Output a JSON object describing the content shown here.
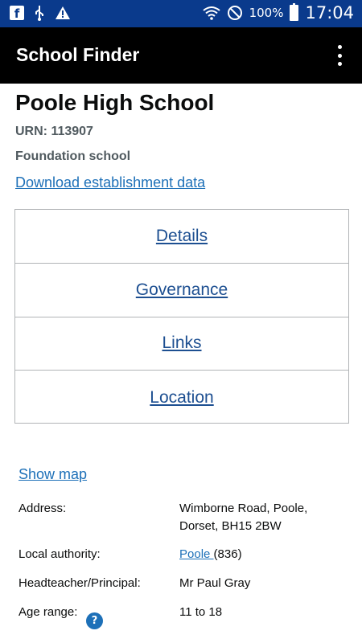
{
  "status_bar": {
    "icons_left": [
      "facebook-icon",
      "usb-icon",
      "warning-icon"
    ],
    "icons_right": [
      "wifi-icon",
      "do-not-disturb-icon",
      "battery-icon"
    ],
    "battery_text": "100%",
    "time": "17:04"
  },
  "app_bar": {
    "title": "School Finder",
    "menu_icon": "more-vert-icon"
  },
  "school": {
    "name": "Poole High School",
    "urn": "URN: 113907",
    "type": "Foundation school",
    "download_link": "Download establishment data"
  },
  "nav": {
    "items": [
      {
        "label": "Details"
      },
      {
        "label": "Governance"
      },
      {
        "label": "Links"
      },
      {
        "label": "Location"
      }
    ]
  },
  "details": {
    "show_map": "Show map",
    "address_label": "Address:",
    "address_line1": "Wimborne Road, Poole,",
    "address_line2": "Dorset, BH15 2BW",
    "la_label": "Local authority:",
    "la_link": "Poole ",
    "la_code": "(836)",
    "head_label": "Headteacher/Principal:",
    "head_value": "Mr Paul Gray",
    "age_label": "Age range:",
    "age_value": "11 to 18",
    "help_glyph": "?"
  },
  "colors": {
    "status_bar": "#0a3a8c",
    "app_bar": "#000000",
    "link": "#1d70b8",
    "secondary_text": "#505a5f"
  }
}
